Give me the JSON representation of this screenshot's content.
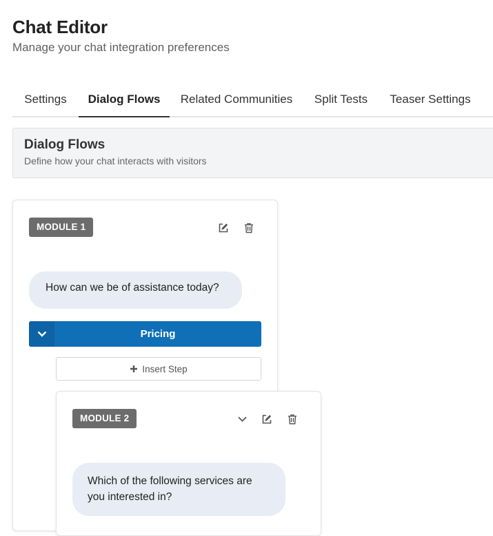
{
  "header": {
    "title": "Chat Editor",
    "subtitle": "Manage your chat integration preferences"
  },
  "tabs": [
    {
      "label": "Settings",
      "active": false
    },
    {
      "label": "Dialog Flows",
      "active": true
    },
    {
      "label": "Related Communities",
      "active": false
    },
    {
      "label": "Split Tests",
      "active": false
    },
    {
      "label": "Teaser Settings",
      "active": false
    }
  ],
  "section": {
    "title": "Dialog Flows",
    "description": "Define how your chat interacts with visitors"
  },
  "modules": [
    {
      "badge": "MODULE 1",
      "question": "How can we be of assistance today?",
      "answer_label": "Pricing",
      "insert_step_label": "Insert Step",
      "icons": [
        "edit-icon",
        "trash-icon"
      ]
    },
    {
      "badge": "MODULE 2",
      "question": "Which of the following services are you interested in?",
      "icons": [
        "chevron-down-icon",
        "edit-icon",
        "trash-icon"
      ]
    }
  ],
  "colors": {
    "answer_bar": "#0f6fb7",
    "answer_chevron_bg": "#0d63a5",
    "badge_bg": "#6c6c6c",
    "bubble_bg": "#e8ecf4",
    "section_bg": "#f3f4f5"
  }
}
